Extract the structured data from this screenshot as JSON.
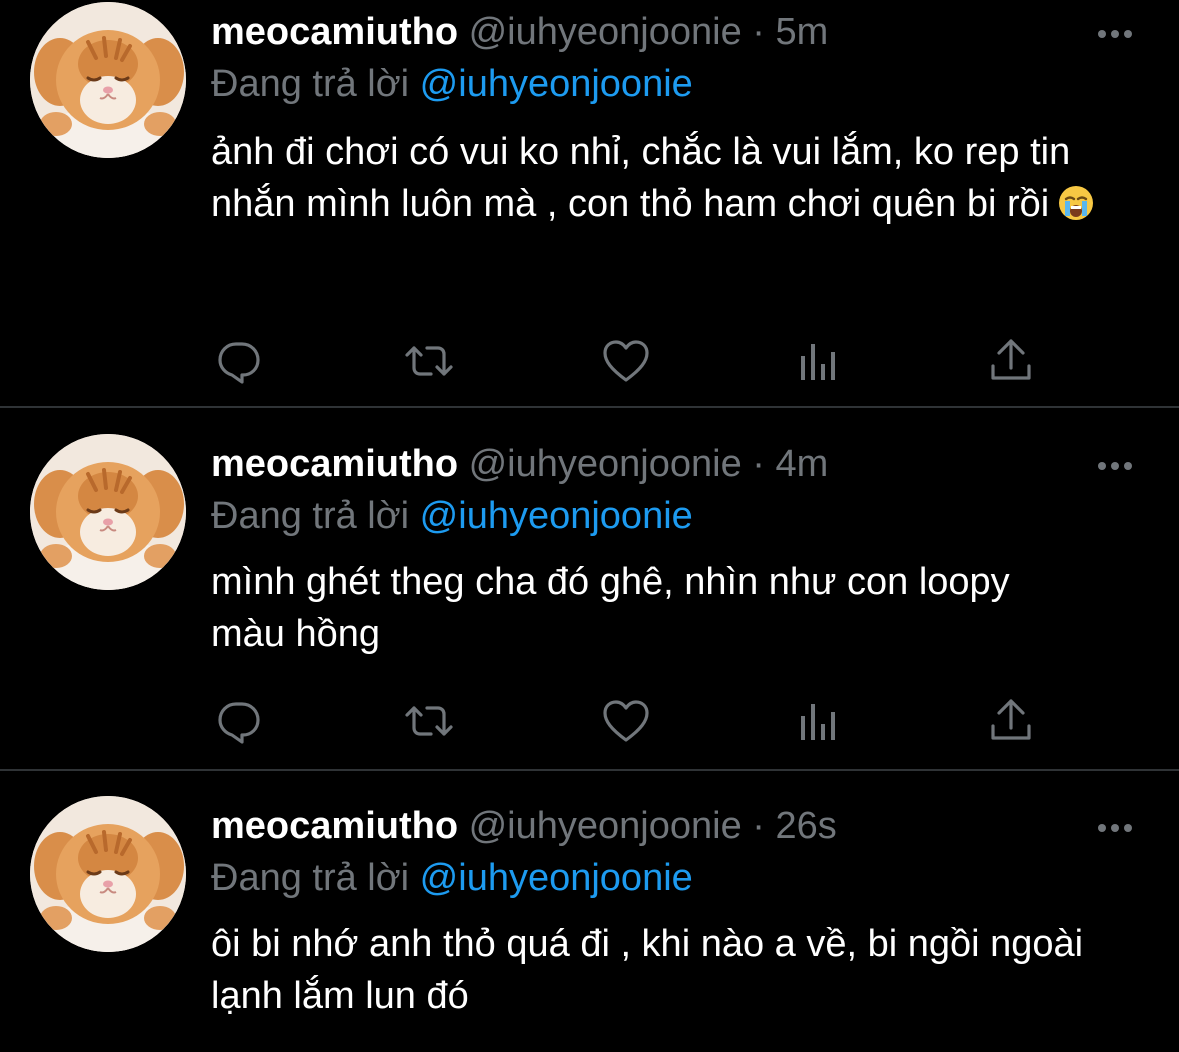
{
  "colors": {
    "background": "#000000",
    "text": "#ffffff",
    "muted": "#71767b",
    "mention": "#1d9bf0",
    "divider": "#2f3336"
  },
  "tweets": [
    {
      "name": "meocamiutho",
      "handle": "@iuhyeonjoonie",
      "separator": "·",
      "time": "5m",
      "replying_label": "Đang trả lời",
      "replying_to": "@iuhyeonjoonie",
      "text": "ảnh đi chơi có vui ko nhỉ, chắc là vui lắm, ko rep tin nhắn mình luôn mà , con thỏ ham chơi quên bi rồi",
      "emoji": "loudly-crying-face-emoji",
      "avatar": "orange-kitten-avatar"
    },
    {
      "name": "meocamiutho",
      "handle": "@iuhyeonjoonie",
      "separator": "·",
      "time": "4m",
      "replying_label": "Đang trả lời",
      "replying_to": "@iuhyeonjoonie",
      "text": "mình ghét theg cha đó ghê, nhìn như con loopy màu hồng",
      "avatar": "orange-kitten-avatar"
    },
    {
      "name": "meocamiutho",
      "handle": "@iuhyeonjoonie",
      "separator": "·",
      "time": "26s",
      "replying_label": "Đang trả lời",
      "replying_to": "@iuhyeonjoonie",
      "text": "ôi bi nhớ anh thỏ quá đi , khi nào a về, bi ngồi ngoài lạnh lắm lun đó",
      "avatar": "orange-kitten-avatar"
    }
  ],
  "action_icons": [
    "reply-icon",
    "retweet-icon",
    "like-icon",
    "analytics-icon",
    "share-icon"
  ],
  "more_icon": "more-options-icon"
}
